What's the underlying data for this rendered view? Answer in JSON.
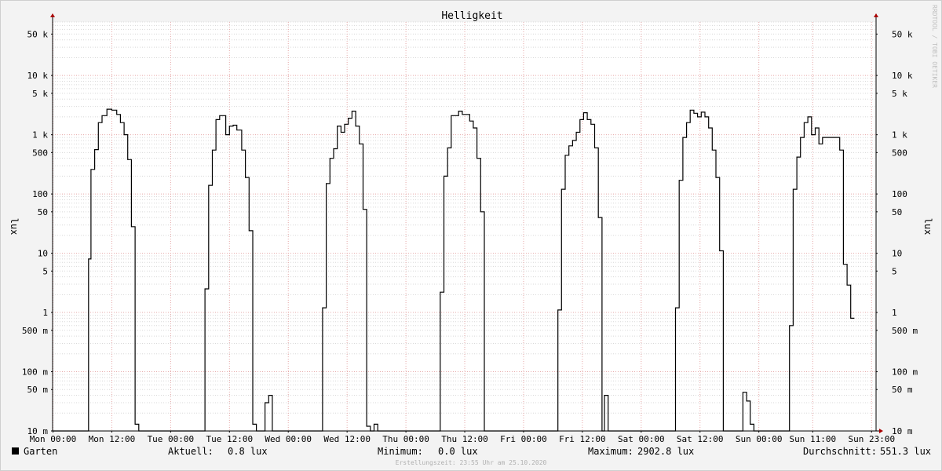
{
  "chart_data": {
    "type": "line",
    "title": "Helligkeit",
    "ylabel": "lux",
    "y_scale": "log",
    "ylim": [
      0.01,
      80000
    ],
    "grid": true,
    "watermark": "RRDTOOL / TOBI OETIKER",
    "y_ticks": [
      {
        "value": 50000,
        "label": "50 k"
      },
      {
        "value": 10000,
        "label": "10 k"
      },
      {
        "value": 5000,
        "label": "5 k"
      },
      {
        "value": 1000,
        "label": "1 k"
      },
      {
        "value": 500,
        "label": "500"
      },
      {
        "value": 100,
        "label": "100"
      },
      {
        "value": 50,
        "label": "50"
      },
      {
        "value": 10,
        "label": "10"
      },
      {
        "value": 5,
        "label": "5"
      },
      {
        "value": 1,
        "label": "1"
      },
      {
        "value": 0.5,
        "label": "500 m"
      },
      {
        "value": 0.1,
        "label": "100 m"
      },
      {
        "value": 0.05,
        "label": "50 m"
      },
      {
        "value": 0.01,
        "label": "10 m"
      }
    ],
    "x_start": "2020-10-18T23:55",
    "x_end": "2020-10-25T23:55",
    "x_ticks": [
      {
        "value": "2020-10-19T00:00",
        "label": "Mon 00:00"
      },
      {
        "value": "2020-10-19T12:00",
        "label": "Mon 12:00"
      },
      {
        "value": "2020-10-20T00:00",
        "label": "Tue 00:00"
      },
      {
        "value": "2020-10-20T12:00",
        "label": "Tue 12:00"
      },
      {
        "value": "2020-10-21T00:00",
        "label": "Wed 00:00"
      },
      {
        "value": "2020-10-21T12:00",
        "label": "Wed 12:00"
      },
      {
        "value": "2020-10-22T00:00",
        "label": "Thu 00:00"
      },
      {
        "value": "2020-10-22T12:00",
        "label": "Thu 12:00"
      },
      {
        "value": "2020-10-23T00:00",
        "label": "Fri 00:00"
      },
      {
        "value": "2020-10-23T12:00",
        "label": "Fri 12:00"
      },
      {
        "value": "2020-10-24T00:00",
        "label": "Sat 00:00"
      },
      {
        "value": "2020-10-24T12:00",
        "label": "Sat 12:00"
      },
      {
        "value": "2020-10-25T00:00",
        "label": "Sun 00:00"
      },
      {
        "value": "2020-10-25T11:00",
        "label": "Sun 11:00"
      },
      {
        "value": "2020-10-25T23:00",
        "label": "Sun 23:00"
      }
    ],
    "series": [
      {
        "name": "Garten",
        "color": "#000000",
        "points": [
          [
            "2020-10-19T00:00",
            0
          ],
          [
            "2020-10-19T07:15",
            0
          ],
          [
            "2020-10-19T07:15",
            8
          ],
          [
            "2020-10-19T07:45",
            8
          ],
          [
            "2020-10-19T07:45",
            260
          ],
          [
            "2020-10-19T08:30",
            260
          ],
          [
            "2020-10-19T08:30",
            560
          ],
          [
            "2020-10-19T09:15",
            560
          ],
          [
            "2020-10-19T09:15",
            1600
          ],
          [
            "2020-10-19T10:00",
            1600
          ],
          [
            "2020-10-19T10:00",
            2100
          ],
          [
            "2020-10-19T11:00",
            2100
          ],
          [
            "2020-10-19T11:00",
            2700
          ],
          [
            "2020-10-19T12:00",
            2700
          ],
          [
            "2020-10-19T12:00",
            2600
          ],
          [
            "2020-10-19T13:00",
            2600
          ],
          [
            "2020-10-19T13:00",
            2200
          ],
          [
            "2020-10-19T13:45",
            2200
          ],
          [
            "2020-10-19T13:45",
            1600
          ],
          [
            "2020-10-19T14:30",
            1600
          ],
          [
            "2020-10-19T14:30",
            1000
          ],
          [
            "2020-10-19T15:15",
            1000
          ],
          [
            "2020-10-19T15:15",
            380
          ],
          [
            "2020-10-19T16:00",
            380
          ],
          [
            "2020-10-19T16:00",
            28
          ],
          [
            "2020-10-19T16:45",
            28
          ],
          [
            "2020-10-19T16:45",
            0.013
          ],
          [
            "2020-10-19T17:30",
            0.013
          ],
          [
            "2020-10-19T17:30",
            0
          ],
          [
            "2020-10-20T07:00",
            0
          ],
          [
            "2020-10-20T07:00",
            2.5
          ],
          [
            "2020-10-20T07:45",
            2.5
          ],
          [
            "2020-10-20T07:45",
            140
          ],
          [
            "2020-10-20T08:30",
            140
          ],
          [
            "2020-10-20T08:30",
            550
          ],
          [
            "2020-10-20T09:15",
            550
          ],
          [
            "2020-10-20T09:15",
            1800
          ],
          [
            "2020-10-20T10:00",
            1800
          ],
          [
            "2020-10-20T10:00",
            2100
          ],
          [
            "2020-10-20T11:15",
            2100
          ],
          [
            "2020-10-20T11:15",
            1000
          ],
          [
            "2020-10-20T12:00",
            1000
          ],
          [
            "2020-10-20T12:00",
            1400
          ],
          [
            "2020-10-20T12:45",
            1400
          ],
          [
            "2020-10-20T12:45",
            1450
          ],
          [
            "2020-10-20T13:30",
            1450
          ],
          [
            "2020-10-20T13:30",
            1200
          ],
          [
            "2020-10-20T14:30",
            1200
          ],
          [
            "2020-10-20T14:30",
            550
          ],
          [
            "2020-10-20T15:15",
            550
          ],
          [
            "2020-10-20T15:15",
            190
          ],
          [
            "2020-10-20T16:00",
            190
          ],
          [
            "2020-10-20T16:00",
            24
          ],
          [
            "2020-10-20T16:45",
            24
          ],
          [
            "2020-10-20T16:45",
            0.013
          ],
          [
            "2020-10-20T17:30",
            0.013
          ],
          [
            "2020-10-20T17:30",
            0
          ],
          [
            "2020-10-20T19:15",
            0
          ],
          [
            "2020-10-20T19:15",
            0.03
          ],
          [
            "2020-10-20T20:00",
            0.03
          ],
          [
            "2020-10-20T20:00",
            0.04
          ],
          [
            "2020-10-20T20:45",
            0.04
          ],
          [
            "2020-10-20T20:45",
            0
          ],
          [
            "2020-10-21T07:00",
            0
          ],
          [
            "2020-10-21T07:00",
            1.2
          ],
          [
            "2020-10-21T07:45",
            1.2
          ],
          [
            "2020-10-21T07:45",
            150
          ],
          [
            "2020-10-21T08:30",
            150
          ],
          [
            "2020-10-21T08:30",
            400
          ],
          [
            "2020-10-21T09:15",
            400
          ],
          [
            "2020-10-21T09:15",
            580
          ],
          [
            "2020-10-21T10:00",
            580
          ],
          [
            "2020-10-21T10:00",
            1400
          ],
          [
            "2020-10-21T10:45",
            1400
          ],
          [
            "2020-10-21T10:45",
            1100
          ],
          [
            "2020-10-21T11:30",
            1100
          ],
          [
            "2020-10-21T11:30",
            1500
          ],
          [
            "2020-10-21T12:15",
            1500
          ],
          [
            "2020-10-21T12:15",
            1900
          ],
          [
            "2020-10-21T13:00",
            1900
          ],
          [
            "2020-10-21T13:00",
            2500
          ],
          [
            "2020-10-21T13:45",
            2500
          ],
          [
            "2020-10-21T13:45",
            1400
          ],
          [
            "2020-10-21T14:30",
            1400
          ],
          [
            "2020-10-21T14:30",
            700
          ],
          [
            "2020-10-21T15:15",
            700
          ],
          [
            "2020-10-21T15:15",
            55
          ],
          [
            "2020-10-21T16:00",
            55
          ],
          [
            "2020-10-21T16:00",
            0.012
          ],
          [
            "2020-10-21T16:45",
            0.012
          ],
          [
            "2020-10-21T16:45",
            0
          ],
          [
            "2020-10-21T17:30",
            0
          ],
          [
            "2020-10-21T17:30",
            0.013
          ],
          [
            "2020-10-21T18:15",
            0.013
          ],
          [
            "2020-10-21T18:15",
            0
          ],
          [
            "2020-10-22T07:00",
            0
          ],
          [
            "2020-10-22T07:00",
            2.2
          ],
          [
            "2020-10-22T07:45",
            2.2
          ],
          [
            "2020-10-22T07:45",
            200
          ],
          [
            "2020-10-22T08:30",
            200
          ],
          [
            "2020-10-22T08:30",
            600
          ],
          [
            "2020-10-22T09:15",
            600
          ],
          [
            "2020-10-22T09:15",
            2100
          ],
          [
            "2020-10-22T10:45",
            2100
          ],
          [
            "2020-10-22T10:45",
            2500
          ],
          [
            "2020-10-22T11:30",
            2500
          ],
          [
            "2020-10-22T11:30",
            2200
          ],
          [
            "2020-10-22T13:00",
            2200
          ],
          [
            "2020-10-22T13:00",
            1700
          ],
          [
            "2020-10-22T13:45",
            1700
          ],
          [
            "2020-10-22T13:45",
            1300
          ],
          [
            "2020-10-22T14:30",
            1300
          ],
          [
            "2020-10-22T14:30",
            400
          ],
          [
            "2020-10-22T15:15",
            400
          ],
          [
            "2020-10-22T15:15",
            50
          ],
          [
            "2020-10-22T16:00",
            50
          ],
          [
            "2020-10-22T16:00",
            0
          ],
          [
            "2020-10-23T07:00",
            0
          ],
          [
            "2020-10-23T07:00",
            1.1
          ],
          [
            "2020-10-23T07:45",
            1.1
          ],
          [
            "2020-10-23T07:45",
            120
          ],
          [
            "2020-10-23T08:30",
            120
          ],
          [
            "2020-10-23T08:30",
            450
          ],
          [
            "2020-10-23T09:15",
            450
          ],
          [
            "2020-10-23T09:15",
            650
          ],
          [
            "2020-10-23T10:00",
            650
          ],
          [
            "2020-10-23T10:00",
            800
          ],
          [
            "2020-10-23T10:45",
            800
          ],
          [
            "2020-10-23T10:45",
            1100
          ],
          [
            "2020-10-23T11:30",
            1100
          ],
          [
            "2020-10-23T11:30",
            1800
          ],
          [
            "2020-10-23T12:15",
            1800
          ],
          [
            "2020-10-23T12:15",
            2350
          ],
          [
            "2020-10-23T13:00",
            2350
          ],
          [
            "2020-10-23T13:00",
            1800
          ],
          [
            "2020-10-23T13:45",
            1800
          ],
          [
            "2020-10-23T13:45",
            1500
          ],
          [
            "2020-10-23T14:30",
            1500
          ],
          [
            "2020-10-23T14:30",
            600
          ],
          [
            "2020-10-23T15:15",
            600
          ],
          [
            "2020-10-23T15:15",
            40
          ],
          [
            "2020-10-23T16:00",
            40
          ],
          [
            "2020-10-23T16:00",
            0
          ],
          [
            "2020-10-23T16:30",
            0
          ],
          [
            "2020-10-23T16:30",
            0.04
          ],
          [
            "2020-10-23T17:15",
            0.04
          ],
          [
            "2020-10-23T17:15",
            0
          ],
          [
            "2020-10-24T07:00",
            0
          ],
          [
            "2020-10-24T07:00",
            1.2
          ],
          [
            "2020-10-24T07:45",
            1.2
          ],
          [
            "2020-10-24T07:45",
            170
          ],
          [
            "2020-10-24T08:30",
            170
          ],
          [
            "2020-10-24T08:30",
            900
          ],
          [
            "2020-10-24T09:15",
            900
          ],
          [
            "2020-10-24T09:15",
            1600
          ],
          [
            "2020-10-24T10:00",
            1600
          ],
          [
            "2020-10-24T10:00",
            2600
          ],
          [
            "2020-10-24T10:45",
            2600
          ],
          [
            "2020-10-24T10:45",
            2300
          ],
          [
            "2020-10-24T11:30",
            2300
          ],
          [
            "2020-10-24T11:30",
            2000
          ],
          [
            "2020-10-24T12:15",
            2000
          ],
          [
            "2020-10-24T12:15",
            2400
          ],
          [
            "2020-10-24T13:00",
            2400
          ],
          [
            "2020-10-24T13:00",
            2000
          ],
          [
            "2020-10-24T13:45",
            2000
          ],
          [
            "2020-10-24T13:45",
            1300
          ],
          [
            "2020-10-24T14:30",
            1300
          ],
          [
            "2020-10-24T14:30",
            550
          ],
          [
            "2020-10-24T15:15",
            550
          ],
          [
            "2020-10-24T15:15",
            190
          ],
          [
            "2020-10-24T16:00",
            190
          ],
          [
            "2020-10-24T16:00",
            11
          ],
          [
            "2020-10-24T16:45",
            11
          ],
          [
            "2020-10-24T16:45",
            0
          ],
          [
            "2020-10-24T20:45",
            0
          ],
          [
            "2020-10-24T20:45",
            0.045
          ],
          [
            "2020-10-24T21:30",
            0.045
          ],
          [
            "2020-10-24T21:30",
            0.032
          ],
          [
            "2020-10-24T22:15",
            0.032
          ],
          [
            "2020-10-24T22:15",
            0.013
          ],
          [
            "2020-10-24T23:00",
            0.013
          ],
          [
            "2020-10-24T23:00",
            0
          ],
          [
            "2020-10-25T06:15",
            0
          ],
          [
            "2020-10-25T06:15",
            0.6
          ],
          [
            "2020-10-25T07:00",
            0.6
          ],
          [
            "2020-10-25T07:00",
            120
          ],
          [
            "2020-10-25T07:45",
            120
          ],
          [
            "2020-10-25T07:45",
            420
          ],
          [
            "2020-10-25T08:30",
            420
          ],
          [
            "2020-10-25T08:30",
            900
          ],
          [
            "2020-10-25T09:15",
            900
          ],
          [
            "2020-10-25T09:15",
            1600
          ],
          [
            "2020-10-25T10:00",
            1600
          ],
          [
            "2020-10-25T10:00",
            2000
          ],
          [
            "2020-10-25T10:45",
            2000
          ],
          [
            "2020-10-25T10:45",
            1000
          ],
          [
            "2020-10-25T11:30",
            1000
          ],
          [
            "2020-10-25T11:30",
            1300
          ],
          [
            "2020-10-25T12:15",
            1300
          ],
          [
            "2020-10-25T12:15",
            700
          ],
          [
            "2020-10-25T13:00",
            700
          ],
          [
            "2020-10-25T13:00",
            900
          ],
          [
            "2020-10-25T16:30",
            900
          ],
          [
            "2020-10-25T16:30",
            550
          ],
          [
            "2020-10-25T17:15",
            550
          ],
          [
            "2020-10-25T17:15",
            6.5
          ],
          [
            "2020-10-25T18:00",
            6.5
          ],
          [
            "2020-10-25T18:00",
            2.9
          ],
          [
            "2020-10-25T18:45",
            2.9
          ],
          [
            "2020-10-25T18:45",
            0.8
          ],
          [
            "2020-10-25T19:30",
            0.8
          ]
        ]
      }
    ],
    "legend": [
      {
        "label": "Garten",
        "color": "#000000"
      }
    ],
    "stats": {
      "current": {
        "label": "Aktuell:",
        "value": "0.8 lux"
      },
      "minimum": {
        "label": "Minimum:",
        "value": "0.0 lux"
      },
      "maximum": {
        "label": "Maximum:",
        "value": "2902.8 lux"
      },
      "average": {
        "label": "Durchschnitt:",
        "value": "551.3 lux"
      }
    },
    "footer": "Erstellungszeit: 23:55 Uhr am 25.10.2020",
    "colors": {
      "background": "#f3f3f3",
      "plot_background": "#ffffff",
      "grid_major": "#e6a8a8",
      "grid_minor": "#d8d8d8",
      "axis": "#000000",
      "arrow": "#aa0000",
      "line": "#000000"
    }
  }
}
